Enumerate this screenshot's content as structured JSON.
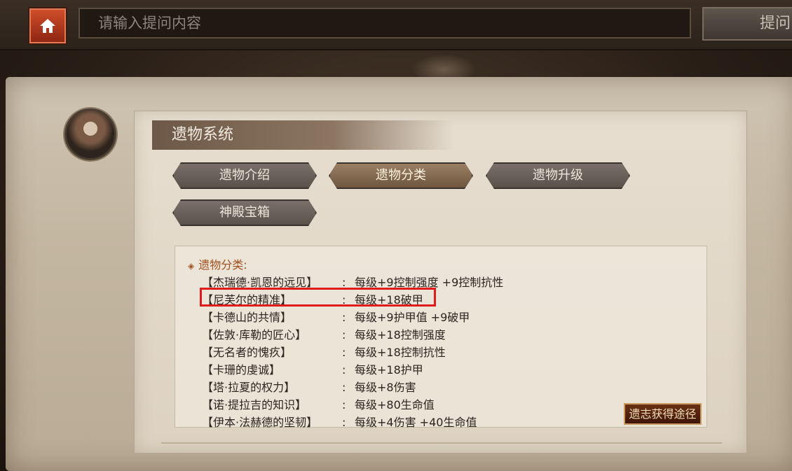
{
  "topbar": {
    "home_icon": "home-icon",
    "search_placeholder": "请输入提问内容",
    "ask_label": "提问"
  },
  "panel": {
    "title": "遗物系统",
    "tabs": [
      "遗物介绍",
      "遗物分类",
      "遗物升级",
      "神殿宝箱"
    ],
    "active_tab": "遗物分类"
  },
  "relics": {
    "section_title": "遗物分类:",
    "items": [
      {
        "name": "【杰瑞德·凯恩的远见】",
        "effect": "每级+9控制强度 +9控制抗性"
      },
      {
        "name": "【尼芙尔的精准】",
        "effect": "每级+18破甲"
      },
      {
        "name": "【卡德山的共情】",
        "effect": "每级+9护甲值 +9破甲"
      },
      {
        "name": "【佐敦·库勒的匠心】",
        "effect": "每级+18控制强度"
      },
      {
        "name": "【无名者的愧疚】",
        "effect": "每级+18控制抗性"
      },
      {
        "name": "【卡珊的虔诚】",
        "effect": "每级+18护甲"
      },
      {
        "name": "【塔·拉夏的权力】",
        "effect": "每级+8伤害"
      },
      {
        "name": "【诺·提拉吉的知识】",
        "effect": "每级+80生命值"
      },
      {
        "name": "【伊本·法赫德的坚韧】",
        "effect": "每级+4伤害 +40生命值"
      }
    ],
    "source_button": "遗志获得途径",
    "highlight_color": "#e01b1b"
  }
}
